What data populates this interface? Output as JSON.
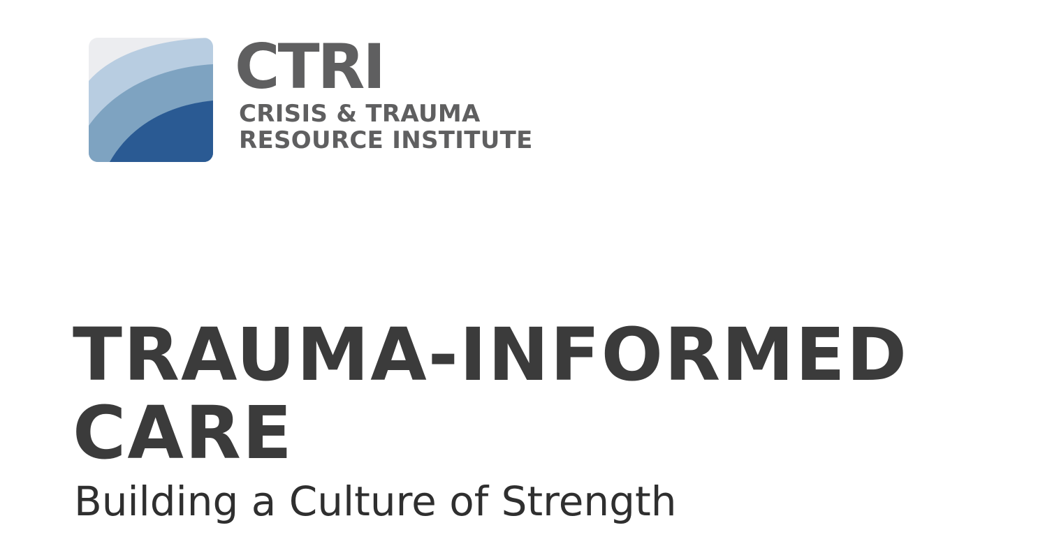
{
  "logo": {
    "acronym": "CTRI",
    "name_line1": "CRISIS & TRAUMA",
    "name_line2": "RESOURCE INSTITUTE",
    "colors": {
      "background": "#ecedf0",
      "light_blue": "#b8cde1",
      "mid_blue": "#7ea3c1",
      "dark_blue": "#2a5a93",
      "text_gray": "#5f5f60"
    }
  },
  "heading": {
    "title_line1": "TRAUMA-INFORMED",
    "title_line2": "CARE",
    "subtitle": "Building a Culture of Strength"
  }
}
